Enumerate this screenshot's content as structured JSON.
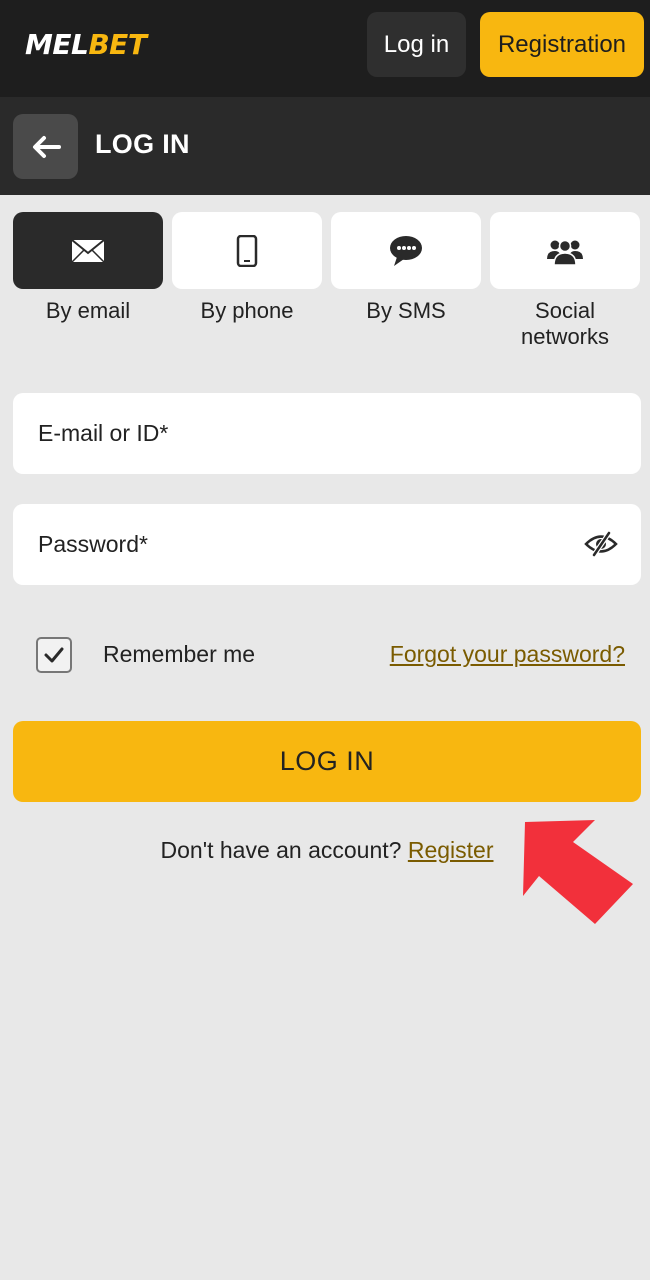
{
  "header": {
    "logo_part1": "MEL",
    "logo_part2": "BET",
    "login_label": "Log in",
    "registration_label": "Registration"
  },
  "subheader": {
    "title": "LOG IN"
  },
  "methods": [
    {
      "label": "By email",
      "icon": "envelope-icon",
      "active": true
    },
    {
      "label": "By phone",
      "icon": "phone-icon",
      "active": false
    },
    {
      "label": "By SMS",
      "icon": "chat-bubble-icon",
      "active": false
    },
    {
      "label": "Social networks",
      "icon": "users-icon",
      "active": false
    }
  ],
  "form": {
    "email_placeholder": "E-mail or ID*",
    "password_placeholder": "Password*",
    "remember_label": "Remember me",
    "remember_checked": true,
    "forgot_label": "Forgot your password?",
    "submit_label": "LOG IN",
    "no_account_text": "Don't have an account?",
    "register_label": "Register"
  },
  "colors": {
    "accent": "#f8b710",
    "header_bg": "#1e1e1e",
    "subheader_bg": "#2a2a2a",
    "page_bg": "#e8e8e8",
    "link": "#7a5b00",
    "arrow": "#f2303b"
  }
}
